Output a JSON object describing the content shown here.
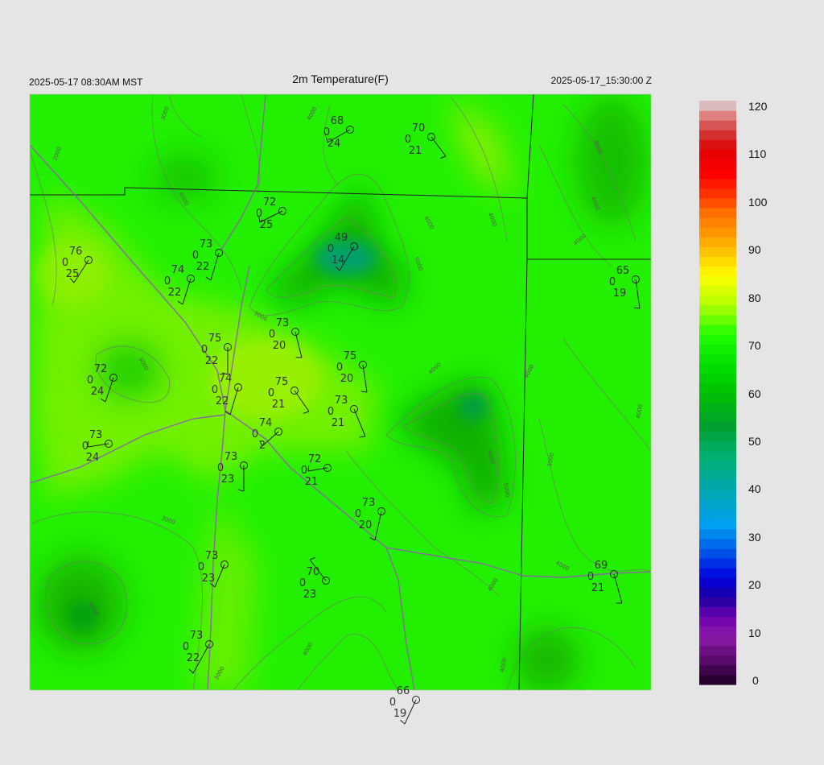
{
  "header": {
    "local_time": "2025-05-17 08:30AM MST",
    "title": "2m Temperature(F)",
    "utc_time": "2025-05-17_15:30:00 Z"
  },
  "colorbar": {
    "labels": [
      "120",
      "110",
      "100",
      "90",
      "80",
      "70",
      "60",
      "50",
      "40",
      "30",
      "20",
      "10",
      "0"
    ],
    "range": [
      0,
      120
    ],
    "stops": [
      {
        "value": 0,
        "color": "#1a0022"
      },
      {
        "value": 5,
        "color": "#5a0a6a"
      },
      {
        "value": 10,
        "color": "#8a1aa8"
      },
      {
        "value": 14,
        "color": "#6a00b0"
      },
      {
        "value": 18,
        "color": "#1a00a0"
      },
      {
        "value": 22,
        "color": "#0000e0"
      },
      {
        "value": 27,
        "color": "#0050e8"
      },
      {
        "value": 33,
        "color": "#00a0f0"
      },
      {
        "value": 40,
        "color": "#00a8b0"
      },
      {
        "value": 47,
        "color": "#00b070"
      },
      {
        "value": 53,
        "color": "#00a030"
      },
      {
        "value": 60,
        "color": "#00c000"
      },
      {
        "value": 66,
        "color": "#00e000"
      },
      {
        "value": 72,
        "color": "#20ff00"
      },
      {
        "value": 78,
        "color": "#b0ff00"
      },
      {
        "value": 84,
        "color": "#ffff00"
      },
      {
        "value": 88,
        "color": "#ffd000"
      },
      {
        "value": 92,
        "color": "#ffa000"
      },
      {
        "value": 97,
        "color": "#ff7000"
      },
      {
        "value": 101,
        "color": "#ff3000"
      },
      {
        "value": 105,
        "color": "#ff0000"
      },
      {
        "value": 110,
        "color": "#e00000"
      },
      {
        "value": 114,
        "color": "#d04040"
      },
      {
        "value": 117,
        "color": "#e08080"
      },
      {
        "value": 120,
        "color": "#d8d8d8"
      }
    ]
  },
  "contour_labels": [
    "2000",
    "3000",
    "3000",
    "3000",
    "3000",
    "4000",
    "4000",
    "4000",
    "4000",
    "4000",
    "4000",
    "4000",
    "4000",
    "4000",
    "4000",
    "4000",
    "5000",
    "5000",
    "5000",
    "3000",
    "4000",
    "4000",
    "4000",
    "4000",
    "3000"
  ],
  "stations": [
    {
      "temp": "68",
      "cloud": "0",
      "dew": "24"
    },
    {
      "temp": "70",
      "cloud": "0",
      "dew": "21"
    },
    {
      "temp": "72",
      "cloud": "0",
      "dew": "25"
    },
    {
      "temp": "49",
      "cloud": "0",
      "dew": "14"
    },
    {
      "temp": "73",
      "cloud": "0",
      "dew": "22"
    },
    {
      "temp": "74",
      "cloud": "0",
      "dew": "22"
    },
    {
      "temp": "76",
      "cloud": "0",
      "dew": "25"
    },
    {
      "temp": "65",
      "cloud": "0",
      "dew": "19"
    },
    {
      "temp": "73",
      "cloud": "0",
      "dew": "20"
    },
    {
      "temp": "75",
      "cloud": "0",
      "dew": "22"
    },
    {
      "temp": "75",
      "cloud": "0",
      "dew": "20"
    },
    {
      "temp": "72",
      "cloud": "0",
      "dew": "24"
    },
    {
      "temp": "74",
      "cloud": "0",
      "dew": "22"
    },
    {
      "temp": "75",
      "cloud": "0",
      "dew": "21"
    },
    {
      "temp": "73",
      "cloud": "0",
      "dew": "21"
    },
    {
      "temp": "73",
      "cloud": "0",
      "dew": "24"
    },
    {
      "temp": "74",
      "cloud": "0",
      "dew": "2"
    },
    {
      "temp": "73",
      "cloud": "0",
      "dew": "23"
    },
    {
      "temp": "72",
      "cloud": "0",
      "dew": "21"
    },
    {
      "temp": "73",
      "cloud": "0",
      "dew": "20"
    },
    {
      "temp": "73",
      "cloud": "0",
      "dew": "23"
    },
    {
      "temp": "70",
      "cloud": "0",
      "dew": "23"
    },
    {
      "temp": "69",
      "cloud": "0",
      "dew": "21"
    },
    {
      "temp": "73",
      "cloud": "0",
      "dew": "22"
    },
    {
      "temp": "66",
      "cloud": "0",
      "dew": "19"
    }
  ]
}
